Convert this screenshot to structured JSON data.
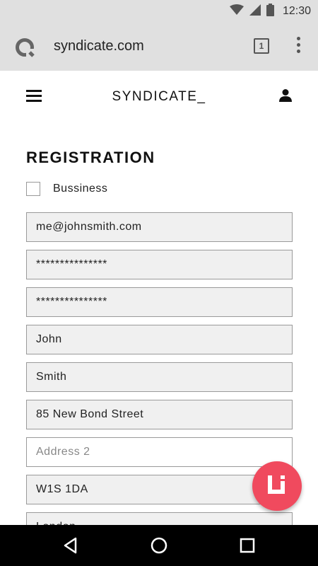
{
  "status_bar": {
    "time": "12:30",
    "icons": [
      "wifi-icon",
      "signal-icon",
      "battery-icon"
    ]
  },
  "browser": {
    "logo_icon": "browser-logo-icon",
    "url": "syndicate.com",
    "tab_count": "1",
    "menu_icon": "overflow-menu-icon"
  },
  "site_header": {
    "menu_icon": "hamburger-icon",
    "logo_text": "SYNDICATE_",
    "account_icon": "account-icon"
  },
  "form": {
    "title": "REGISTRATION",
    "business_checkbox_label": "Bussiness",
    "business_checked": false,
    "fields": {
      "email": {
        "value": "me@johnsmith.com",
        "placeholder": ""
      },
      "password": {
        "value": "***************",
        "placeholder": ""
      },
      "confirm_password": {
        "value": "***************",
        "placeholder": ""
      },
      "first_name": {
        "value": "John",
        "placeholder": ""
      },
      "last_name": {
        "value": "Smith",
        "placeholder": ""
      },
      "address_1": {
        "value": "85 New Bond Street",
        "placeholder": ""
      },
      "address_2": {
        "value": "",
        "placeholder": "Address 2"
      },
      "postcode": {
        "value": "W1S 1DA",
        "placeholder": ""
      },
      "city": {
        "value": "London",
        "placeholder": ""
      }
    }
  },
  "fab": {
    "icon": "brand-logo-icon",
    "color": "#f04a5e"
  },
  "nav_bar": {
    "back_icon": "back-icon",
    "home_icon": "home-icon",
    "recents_icon": "recents-icon"
  },
  "colors": {
    "chrome_gray": "#e0e0e0",
    "field_fill": "#f0f0f0",
    "accent": "#f04a5e"
  }
}
